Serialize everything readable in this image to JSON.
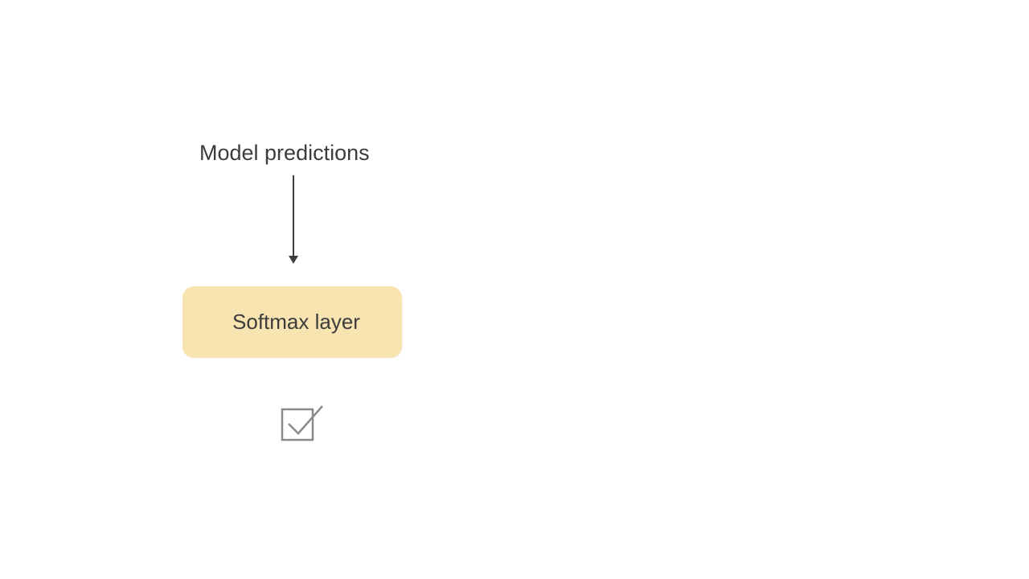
{
  "diagram": {
    "top_label": "Model predictions",
    "box_label": "Softmax layer",
    "box_color": "#f8e4b0",
    "arrow_color": "#3c3c3c",
    "icon_stroke": "#8a8a8a"
  }
}
